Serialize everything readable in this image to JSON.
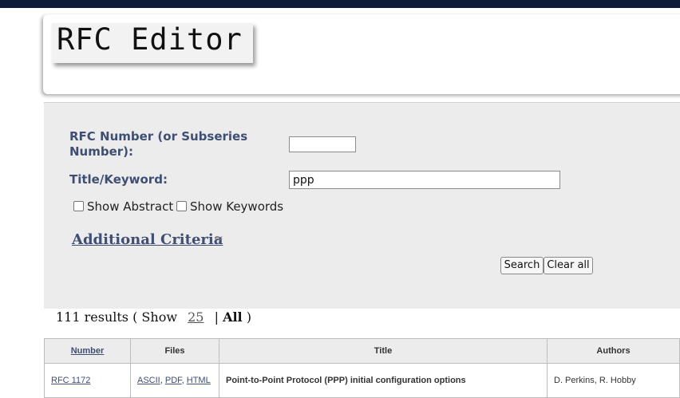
{
  "header": {
    "logo_text": "RFC Editor"
  },
  "search": {
    "rfc_number_label": "RFC Number (or Subseries Number):",
    "rfc_number_value": "",
    "title_label": "Title/Keyword:",
    "title_value": "ppp",
    "show_abstract_label": "Show Abstract",
    "show_keywords_label": "Show Keywords",
    "additional_criteria_label": "Additional Criteria",
    "search_button": "Search",
    "clear_button": "Clear all"
  },
  "results": {
    "count_text": "111 results ( Show",
    "show_25": "25",
    "separator": "|",
    "show_all": "All",
    "close_paren": ")"
  },
  "table": {
    "headers": [
      "Number",
      "Files",
      "Title",
      "Authors"
    ],
    "rows": [
      {
        "number": "RFC 1172",
        "files": [
          "ASCII",
          "PDF",
          "HTML"
        ],
        "title": "Point-to-Point Protocol (PPP) initial configuration options",
        "authors": "D. Perkins, R. Hobby"
      }
    ]
  },
  "colors": {
    "topbar": "#0f1b38",
    "label": "#3f4e73",
    "panel": "#ececec"
  }
}
